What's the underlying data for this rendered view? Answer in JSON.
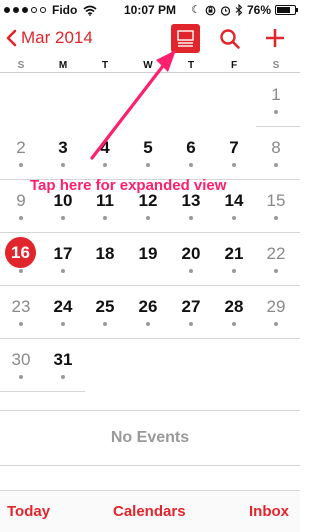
{
  "status_bar": {
    "carrier": "Fido",
    "time": "10:07 PM",
    "battery": "76%",
    "battery_level": 0.76,
    "signal_filled": 3,
    "signal_total": 5,
    "icons": [
      "wifi-icon",
      "moon-icon",
      "lock-rotation-icon",
      "alarm-icon",
      "bluetooth-icon",
      "battery-icon"
    ]
  },
  "nav": {
    "back_label": "Mar 2014",
    "icons": [
      "chevron-left-icon",
      "list-view-icon",
      "search-icon",
      "plus-icon"
    ]
  },
  "weekdays": [
    "S",
    "M",
    "T",
    "W",
    "T",
    "F",
    "S"
  ],
  "weeks": [
    [
      null,
      null,
      null,
      null,
      null,
      null,
      {
        "day": "1",
        "dot": true
      }
    ],
    [
      {
        "day": "2",
        "dot": true
      },
      {
        "day": "3",
        "dot": true
      },
      {
        "day": "4",
        "dot": true
      },
      {
        "day": "5",
        "dot": true
      },
      {
        "day": "6",
        "dot": true
      },
      {
        "day": "7",
        "dot": true
      },
      {
        "day": "8",
        "dot": true
      }
    ],
    [
      {
        "day": "9",
        "dot": true
      },
      {
        "day": "10",
        "dot": true
      },
      {
        "day": "11",
        "dot": true
      },
      {
        "day": "12",
        "dot": true
      },
      {
        "day": "13",
        "dot": true
      },
      {
        "day": "14",
        "dot": true
      },
      {
        "day": "15",
        "dot": true
      }
    ],
    [
      {
        "day": "16",
        "dot": true,
        "today": true
      },
      {
        "day": "17",
        "dot": true
      },
      {
        "day": "18",
        "dot": false
      },
      {
        "day": "19",
        "dot": false
      },
      {
        "day": "20",
        "dot": true
      },
      {
        "day": "21",
        "dot": true
      },
      {
        "day": "22",
        "dot": true
      }
    ],
    [
      {
        "day": "23",
        "dot": true
      },
      {
        "day": "24",
        "dot": true
      },
      {
        "day": "25",
        "dot": true
      },
      {
        "day": "26",
        "dot": true
      },
      {
        "day": "27",
        "dot": true
      },
      {
        "day": "28",
        "dot": true
      },
      {
        "day": "29",
        "dot": true
      }
    ],
    [
      {
        "day": "30",
        "dot": true
      },
      {
        "day": "31",
        "dot": true
      },
      null,
      null,
      null,
      null,
      null
    ]
  ],
  "annotation": {
    "text": "Tap here for expanded view",
    "color": "#ff1f6d"
  },
  "events": {
    "empty_label": "No Events"
  },
  "toolbar": {
    "today_label": "Today",
    "calendars_label": "Calendars",
    "inbox_label": "Inbox"
  },
  "colors": {
    "accent": "#e0262c",
    "weekend_text": "#8a8a8a",
    "dot": "#9a9a9a"
  }
}
